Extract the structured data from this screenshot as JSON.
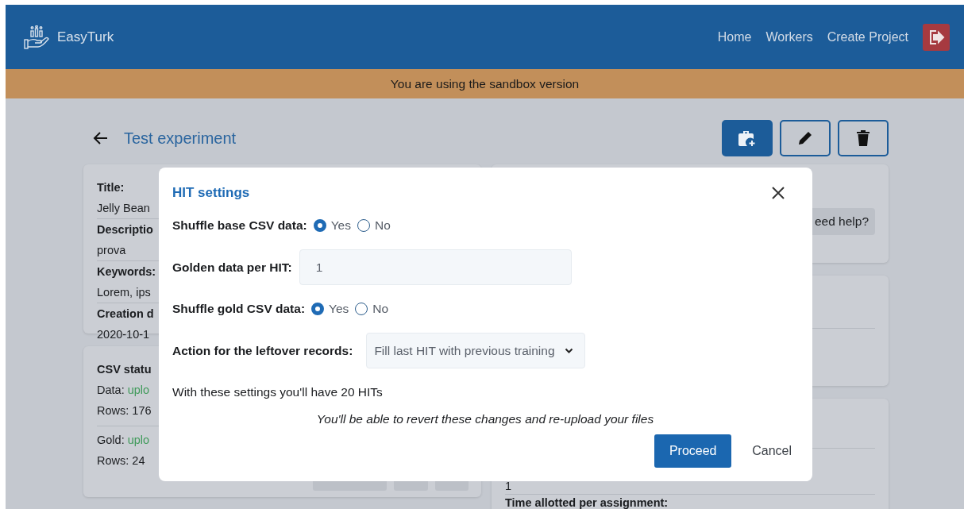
{
  "navbar": {
    "brand": "EasyTurk",
    "links": [
      "Home",
      "Workers",
      "Create Project"
    ]
  },
  "banner": {
    "text": "You are using the sandbox version"
  },
  "page": {
    "title": "Test experiment"
  },
  "info_card": {
    "fields": [
      {
        "label": "Title:",
        "value": "Jelly Bean"
      },
      {
        "label": "Descriptio",
        "value": "prova"
      },
      {
        "label": "Keywords:",
        "value": "Lorem, ips"
      },
      {
        "label": "Creation d",
        "value": "2020-10-1"
      }
    ]
  },
  "csv_card": {
    "heading": "CSV statu",
    "entries": [
      {
        "label": "Data:",
        "status": "uplo",
        "rows": "Rows: 176"
      },
      {
        "label": "Gold:",
        "status": "uplo",
        "rows": "Rows: 24"
      }
    ]
  },
  "help_card": {
    "button": "eed help?"
  },
  "details_card": {
    "value": "1",
    "label": "Time allotted per assignment:"
  },
  "modal": {
    "title": "HIT settings",
    "rows": [
      {
        "kind": "radio",
        "label": "Shuffle base CSV data:",
        "options": [
          {
            "label": "Yes",
            "selected": true
          },
          {
            "label": "No",
            "selected": false
          }
        ]
      },
      {
        "kind": "input",
        "label": "Golden data per HIT:",
        "value": "1"
      },
      {
        "kind": "radio",
        "label": "Shuffle gold CSV data:",
        "options": [
          {
            "label": "Yes",
            "selected": true
          },
          {
            "label": "No",
            "selected": false
          }
        ]
      },
      {
        "kind": "select",
        "label": "Action for the leftover records:",
        "value": "Fill last HIT with previous training"
      }
    ],
    "summary": "With these settings you'll have 20 HITs",
    "note": "You'll be able to revert these changes and re-upload your files",
    "buttons": {
      "primary": "Proceed",
      "secondary": "Cancel"
    }
  }
}
